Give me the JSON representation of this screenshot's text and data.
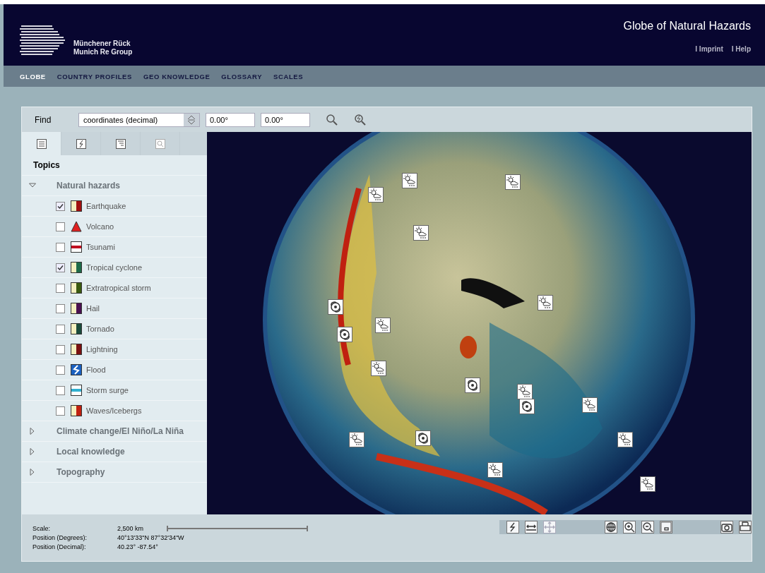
{
  "header": {
    "logo_line_1": "Münchener Rück",
    "logo_line_2": "Munich Re Group",
    "title": "Globe of Natural Hazards",
    "links": [
      "I Imprint",
      "I Help"
    ]
  },
  "nav": [
    {
      "label": "GLOBE",
      "selected": true
    },
    {
      "label": "COUNTRY PROFILES",
      "selected": false
    },
    {
      "label": "GEO KNOWLEDGE",
      "selected": false
    },
    {
      "label": "GLOSSARY",
      "selected": false
    },
    {
      "label": "SCALES",
      "selected": false
    }
  ],
  "find": {
    "label": "Find",
    "mode": "coordinates (decimal)",
    "latitude": "0.00°",
    "longitude": "0.00°"
  },
  "tabs": [
    {
      "kind": "list",
      "selected": true
    },
    {
      "kind": "lightning",
      "selected": false
    },
    {
      "kind": "document",
      "selected": false
    },
    {
      "kind": "search",
      "selected": false
    }
  ],
  "sidebar": {
    "heading": "Topics",
    "groups": [
      {
        "label": "Natural hazards",
        "expanded": true,
        "children": [
          {
            "label": "Earthquake",
            "checked": true,
            "kind": "bar",
            "color": "#a01010"
          },
          {
            "label": "Volcano",
            "checked": false,
            "kind": "triangle",
            "color": "#e02020"
          },
          {
            "label": "Tsunami",
            "checked": false,
            "kind": "line",
            "color": "#c01020"
          },
          {
            "label": "Tropical cyclone",
            "checked": true,
            "kind": "bar",
            "color": "#1e6a48"
          },
          {
            "label": "Extratropical storm",
            "checked": false,
            "kind": "bar",
            "color": "#3a5a10"
          },
          {
            "label": "Hail",
            "checked": false,
            "kind": "bar",
            "color": "#4a1050"
          },
          {
            "label": "Tornado",
            "checked": false,
            "kind": "bar",
            "color": "#1a4a3a"
          },
          {
            "label": "Lightning",
            "checked": false,
            "kind": "bar",
            "color": "#7a1010"
          },
          {
            "label": "Flood",
            "checked": false,
            "kind": "flood",
            "color": "#1a60c0"
          },
          {
            "label": "Storm surge",
            "checked": false,
            "kind": "line",
            "color": "#30b0d0"
          },
          {
            "label": "Waves/Icebergs",
            "checked": false,
            "kind": "bar",
            "color": "#c02010"
          }
        ]
      },
      {
        "label": "Climate change/El Niño/La Niña",
        "expanded": false
      },
      {
        "label": "Local knowledge",
        "expanded": false
      },
      {
        "label": "Topography",
        "expanded": false
      }
    ]
  },
  "status": {
    "scale_label": "Scale:",
    "scale_value": "2,500 km",
    "degrees_label": "Position (Degrees):",
    "degrees_value": "40°13'33\"N 87°32'34\"W",
    "decimal_label": "Position (Decimal):",
    "decimal_value": "40.23° -87.54°"
  },
  "toolbar": [
    {
      "kind": "lightning",
      "disabled": false
    },
    {
      "kind": "measure",
      "disabled": false
    },
    {
      "kind": "move",
      "disabled": true
    },
    {
      "kind": "globe",
      "disabled": false
    },
    {
      "kind": "zoom-in",
      "disabled": false
    },
    {
      "kind": "zoom-out",
      "disabled": false
    },
    {
      "kind": "window",
      "disabled": false
    },
    {
      "kind": "camera",
      "disabled": false
    },
    {
      "kind": "print",
      "disabled": false
    }
  ]
}
